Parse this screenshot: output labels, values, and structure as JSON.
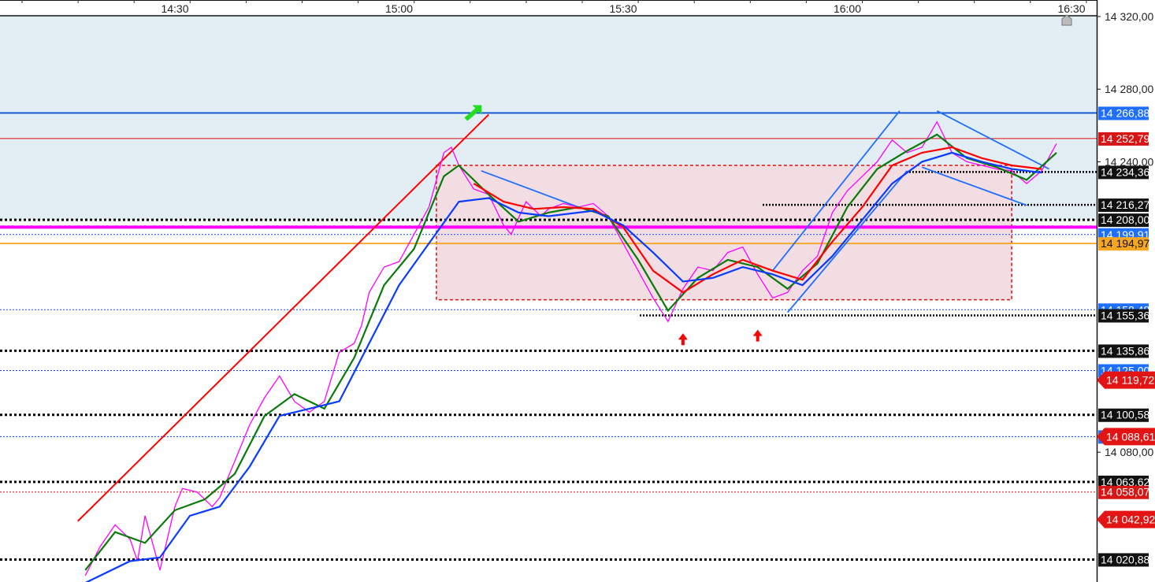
{
  "chart_data": {
    "type": "line",
    "time_labels": [
      "14:30",
      "15:00",
      "15:30",
      "16:00",
      "16:30"
    ],
    "price_scale_labels": [
      "14 320,00",
      "14 280,00",
      "14 240,00",
      "14 080,00"
    ],
    "ylim": [
      14015,
      14320
    ],
    "colors": {
      "background_zone": "#e3eef4",
      "price_line": "#ff00ff",
      "fast_ma": "#0a7a0a",
      "mid_ma": "#ff0000",
      "slow_ma": "#0a3cff",
      "trend_red": "#ff0000",
      "channel_blue": "#1f6fff",
      "range_box": "#f2dde2"
    },
    "horizontal_levels": [
      {
        "label": "14 266,88",
        "value": 14266.88,
        "style": "solid",
        "line_color": "#0a50d8",
        "tag_bg": "#1f6fff",
        "tag_fg": "#ffffff"
      },
      {
        "label": "14 252,79",
        "value": 14252.79,
        "style": "thin",
        "line_color": "#e01010",
        "tag_bg": "#d81515",
        "tag_fg": "#ffffff"
      },
      {
        "label": "14 234,36",
        "value": 14234.36,
        "style": "dotted-partial",
        "line_color": "#000000",
        "tag_bg": "#111111",
        "tag_fg": "#ffffff"
      },
      {
        "label": "14 216,27",
        "value": 14216.27,
        "style": "dotted-partial",
        "line_color": "#000000",
        "tag_bg": "#111111",
        "tag_fg": "#ffffff"
      },
      {
        "label": "14 208,00",
        "value": 14208.0,
        "style": "dotted-bold",
        "line_color": "#000000",
        "tag_bg": "#111111",
        "tag_fg": "#ffffff"
      },
      {
        "label": "14 199,91",
        "value": 14199.91,
        "style": "dotted-thin",
        "line_color": "#0a50d8",
        "tag_bg": "#1f6fff",
        "tag_fg": "#ffffff"
      },
      {
        "label": "14 194,97",
        "value": 14194.97,
        "style": "solid",
        "line_color": "#f5a623",
        "tag_bg": "#f5a623",
        "tag_fg": "#111111"
      },
      {
        "label": "14 158,48",
        "value": 14158.48,
        "style": "dotted-thin",
        "line_color": "#0a50d8",
        "tag_bg": "#1f6fff",
        "tag_fg": "#ffffff"
      },
      {
        "label": "14 155,36",
        "value": 14155.36,
        "style": "dotted-partial",
        "line_color": "#000000",
        "tag_bg": "#111111",
        "tag_fg": "#ffffff"
      },
      {
        "label": "14 135,86",
        "value": 14135.86,
        "style": "dotted-bold",
        "line_color": "#000000",
        "tag_bg": "#111111",
        "tag_fg": "#ffffff"
      },
      {
        "label": "14 125,00",
        "value": 14125.0,
        "style": "dotted-thin",
        "line_color": "#0a50d8",
        "tag_bg": "#1f6fff",
        "tag_fg": "#ffffff"
      },
      {
        "label": "14 100,58",
        "value": 14100.58,
        "style": "dotted-bold",
        "line_color": "#000000",
        "tag_bg": "#111111",
        "tag_fg": "#ffffff"
      },
      {
        "label": "14 088,61",
        "value": 14088.61,
        "style": "dotted-thin",
        "line_color": "#0a50d8",
        "tag_bg": "#1f6fff",
        "tag_fg": "#ffffff"
      },
      {
        "label": "14 063,62",
        "value": 14063.62,
        "style": "dotted-bold",
        "line_color": "#000000",
        "tag_bg": "#111111",
        "tag_fg": "#ffffff"
      },
      {
        "label": "14 058,07",
        "value": 14058.07,
        "style": "dotted-red",
        "line_color": "#e01010",
        "tag_bg": "#d81515",
        "tag_fg": "#ffffff"
      },
      {
        "label": "14 020,88",
        "value": 14020.88,
        "style": "dotted-bold",
        "line_color": "#000000",
        "tag_bg": "#111111",
        "tag_fg": "#ffffff"
      }
    ],
    "side_arrow_tags": [
      {
        "label": "14 119,72",
        "value": 14119.72
      },
      {
        "label": "14 088,61",
        "value": 14088.61
      },
      {
        "label": "14 042,92",
        "value": 14042.92
      }
    ],
    "price_series": {
      "name": "",
      "points": [
        {
          "t": "14:18",
          "p": 14012
        },
        {
          "t": "14:20",
          "p": 14028
        },
        {
          "t": "14:22",
          "p": 14040
        },
        {
          "t": "14:24",
          "p": 14032
        },
        {
          "t": "14:25",
          "p": 14020
        },
        {
          "t": "14:26",
          "p": 14045
        },
        {
          "t": "14:27",
          "p": 14030
        },
        {
          "t": "14:28",
          "p": 14015
        },
        {
          "t": "14:30",
          "p": 14050
        },
        {
          "t": "14:31",
          "p": 14060
        },
        {
          "t": "14:33",
          "p": 14058
        },
        {
          "t": "14:35",
          "p": 14050
        },
        {
          "t": "14:36",
          "p": 14055
        },
        {
          "t": "14:38",
          "p": 14075
        },
        {
          "t": "14:40",
          "p": 14095
        },
        {
          "t": "14:42",
          "p": 14110
        },
        {
          "t": "14:44",
          "p": 14122
        },
        {
          "t": "14:46",
          "p": 14108
        },
        {
          "t": "14:48",
          "p": 14102
        },
        {
          "t": "14:50",
          "p": 14108
        },
        {
          "t": "14:52",
          "p": 14135
        },
        {
          "t": "14:54",
          "p": 14140
        },
        {
          "t": "14:55",
          "p": 14150
        },
        {
          "t": "14:56",
          "p": 14168
        },
        {
          "t": "14:58",
          "p": 14182
        },
        {
          "t": "15:00",
          "p": 14185
        },
        {
          "t": "15:02",
          "p": 14200
        },
        {
          "t": "15:04",
          "p": 14215
        },
        {
          "t": "15:06",
          "p": 14245
        },
        {
          "t": "15:07",
          "p": 14248
        },
        {
          "t": "15:08",
          "p": 14238
        },
        {
          "t": "15:10",
          "p": 14225
        },
        {
          "t": "15:12",
          "p": 14222
        },
        {
          "t": "15:14",
          "p": 14205
        },
        {
          "t": "15:15",
          "p": 14200
        },
        {
          "t": "15:17",
          "p": 14218
        },
        {
          "t": "15:19",
          "p": 14210
        },
        {
          "t": "15:20",
          "p": 14214
        },
        {
          "t": "15:22",
          "p": 14217
        },
        {
          "t": "15:24",
          "p": 14215
        },
        {
          "t": "15:26",
          "p": 14217
        },
        {
          "t": "15:28",
          "p": 14210
        },
        {
          "t": "15:30",
          "p": 14195
        },
        {
          "t": "15:32",
          "p": 14180
        },
        {
          "t": "15:34",
          "p": 14165
        },
        {
          "t": "15:36",
          "p": 14152
        },
        {
          "t": "15:38",
          "p": 14170
        },
        {
          "t": "15:40",
          "p": 14182
        },
        {
          "t": "15:42",
          "p": 14180
        },
        {
          "t": "15:44",
          "p": 14190
        },
        {
          "t": "15:46",
          "p": 14193
        },
        {
          "t": "15:48",
          "p": 14178
        },
        {
          "t": "15:50",
          "p": 14165
        },
        {
          "t": "15:52",
          "p": 14168
        },
        {
          "t": "15:54",
          "p": 14180
        },
        {
          "t": "15:56",
          "p": 14188
        },
        {
          "t": "15:58",
          "p": 14212
        },
        {
          "t": "16:00",
          "p": 14224
        },
        {
          "t": "16:02",
          "p": 14232
        },
        {
          "t": "16:04",
          "p": 14240
        },
        {
          "t": "16:06",
          "p": 14252
        },
        {
          "t": "16:08",
          "p": 14245
        },
        {
          "t": "16:10",
          "p": 14248
        },
        {
          "t": "16:12",
          "p": 14262
        },
        {
          "t": "16:14",
          "p": 14245
        },
        {
          "t": "16:16",
          "p": 14240
        },
        {
          "t": "16:18",
          "p": 14238
        },
        {
          "t": "16:20",
          "p": 14236
        },
        {
          "t": "16:22",
          "p": 14235
        },
        {
          "t": "16:24",
          "p": 14228
        },
        {
          "t": "16:26",
          "p": 14235
        },
        {
          "t": "16:28",
          "p": 14250
        }
      ]
    },
    "moving_averages": [
      {
        "name": "",
        "color": "#0a7a0a",
        "points": [
          {
            "t": "14:18",
            "p": 14015
          },
          {
            "t": "14:22",
            "p": 14036
          },
          {
            "t": "14:26",
            "p": 14030
          },
          {
            "t": "14:30",
            "p": 14048
          },
          {
            "t": "14:34",
            "p": 14054
          },
          {
            "t": "14:38",
            "p": 14068
          },
          {
            "t": "14:42",
            "p": 14100
          },
          {
            "t": "14:46",
            "p": 14112
          },
          {
            "t": "14:50",
            "p": 14104
          },
          {
            "t": "14:54",
            "p": 14132
          },
          {
            "t": "14:58",
            "p": 14172
          },
          {
            "t": "15:02",
            "p": 14192
          },
          {
            "t": "15:06",
            "p": 14232
          },
          {
            "t": "15:08",
            "p": 14238
          },
          {
            "t": "15:12",
            "p": 14222
          },
          {
            "t": "15:16",
            "p": 14207
          },
          {
            "t": "15:20",
            "p": 14212
          },
          {
            "t": "15:24",
            "p": 14215
          },
          {
            "t": "15:28",
            "p": 14210
          },
          {
            "t": "15:32",
            "p": 14186
          },
          {
            "t": "15:36",
            "p": 14158
          },
          {
            "t": "15:40",
            "p": 14176
          },
          {
            "t": "15:44",
            "p": 14186
          },
          {
            "t": "15:48",
            "p": 14182
          },
          {
            "t": "15:52",
            "p": 14170
          },
          {
            "t": "15:56",
            "p": 14184
          },
          {
            "t": "16:00",
            "p": 14215
          },
          {
            "t": "16:04",
            "p": 14236
          },
          {
            "t": "16:08",
            "p": 14246
          },
          {
            "t": "16:12",
            "p": 14255
          },
          {
            "t": "16:16",
            "p": 14242
          },
          {
            "t": "16:20",
            "p": 14237
          },
          {
            "t": "16:24",
            "p": 14230
          },
          {
            "t": "16:28",
            "p": 14245
          }
        ]
      },
      {
        "name": "",
        "color": "#ff0000",
        "points": [
          {
            "t": "15:10",
            "p": 14228
          },
          {
            "t": "15:14",
            "p": 14218
          },
          {
            "t": "15:18",
            "p": 14214
          },
          {
            "t": "15:22",
            "p": 14215
          },
          {
            "t": "15:26",
            "p": 14214
          },
          {
            "t": "15:30",
            "p": 14204
          },
          {
            "t": "15:34",
            "p": 14180
          },
          {
            "t": "15:38",
            "p": 14168
          },
          {
            "t": "15:42",
            "p": 14178
          },
          {
            "t": "15:46",
            "p": 14186
          },
          {
            "t": "15:50",
            "p": 14180
          },
          {
            "t": "15:54",
            "p": 14175
          },
          {
            "t": "15:58",
            "p": 14196
          },
          {
            "t": "16:02",
            "p": 14215
          },
          {
            "t": "16:06",
            "p": 14238
          },
          {
            "t": "16:10",
            "p": 14245
          },
          {
            "t": "16:14",
            "p": 14248
          },
          {
            "t": "16:18",
            "p": 14242
          },
          {
            "t": "16:22",
            "p": 14238
          },
          {
            "t": "16:26",
            "p": 14236
          }
        ]
      },
      {
        "name": "",
        "color": "#0a3cff",
        "points": [
          {
            "t": "14:18",
            "p": 14008
          },
          {
            "t": "14:24",
            "p": 14020
          },
          {
            "t": "14:28",
            "p": 14022
          },
          {
            "t": "14:32",
            "p": 14045
          },
          {
            "t": "14:36",
            "p": 14050
          },
          {
            "t": "14:40",
            "p": 14072
          },
          {
            "t": "14:44",
            "p": 14100
          },
          {
            "t": "14:48",
            "p": 14104
          },
          {
            "t": "14:52",
            "p": 14108
          },
          {
            "t": "14:56",
            "p": 14140
          },
          {
            "t": "15:00",
            "p": 14172
          },
          {
            "t": "15:04",
            "p": 14195
          },
          {
            "t": "15:08",
            "p": 14218
          },
          {
            "t": "15:12",
            "p": 14220
          },
          {
            "t": "15:16",
            "p": 14212
          },
          {
            "t": "15:20",
            "p": 14210
          },
          {
            "t": "15:26",
            "p": 14213
          },
          {
            "t": "15:30",
            "p": 14205
          },
          {
            "t": "15:34",
            "p": 14190
          },
          {
            "t": "15:38",
            "p": 14174
          },
          {
            "t": "15:42",
            "p": 14176
          },
          {
            "t": "15:46",
            "p": 14182
          },
          {
            "t": "15:50",
            "p": 14178
          },
          {
            "t": "15:54",
            "p": 14172
          },
          {
            "t": "15:58",
            "p": 14188
          },
          {
            "t": "16:02",
            "p": 14208
          },
          {
            "t": "16:06",
            "p": 14228
          },
          {
            "t": "16:10",
            "p": 14240
          },
          {
            "t": "16:14",
            "p": 14245
          },
          {
            "t": "16:18",
            "p": 14240
          },
          {
            "t": "16:22",
            "p": 14236
          },
          {
            "t": "16:26",
            "p": 14234
          }
        ]
      }
    ],
    "drawings": {
      "trend_line": {
        "from": {
          "t": "14:17",
          "p": 14042
        },
        "to": {
          "t": "15:12",
          "p": 14266
        }
      },
      "range_box": {
        "from_t": "15:05",
        "to_t": "16:22",
        "top": 14238,
        "bottom": 14164
      },
      "channel_lines": [
        {
          "from": {
            "t": "15:50",
            "p": 14180
          },
          "to": {
            "t": "16:07",
            "p": 14268
          }
        },
        {
          "from": {
            "t": "15:52",
            "p": 14157
          },
          "to": {
            "t": "16:08",
            "p": 14235
          }
        },
        {
          "from": {
            "t": "15:11",
            "p": 14235
          },
          "to": {
            "t": "15:24",
            "p": 14215
          }
        },
        {
          "from": {
            "t": "16:12",
            "p": 14268
          },
          "to": {
            "t": "16:27",
            "p": 14236
          }
        },
        {
          "from": {
            "t": "16:10",
            "p": 14237
          },
          "to": {
            "t": "16:24",
            "p": 14216
          }
        }
      ],
      "up_arrows": [
        {
          "t": "15:38",
          "p": 14142
        },
        {
          "t": "15:48",
          "p": 14144
        }
      ],
      "green_arrow": {
        "t": "15:10",
        "p": 14266
      }
    }
  }
}
